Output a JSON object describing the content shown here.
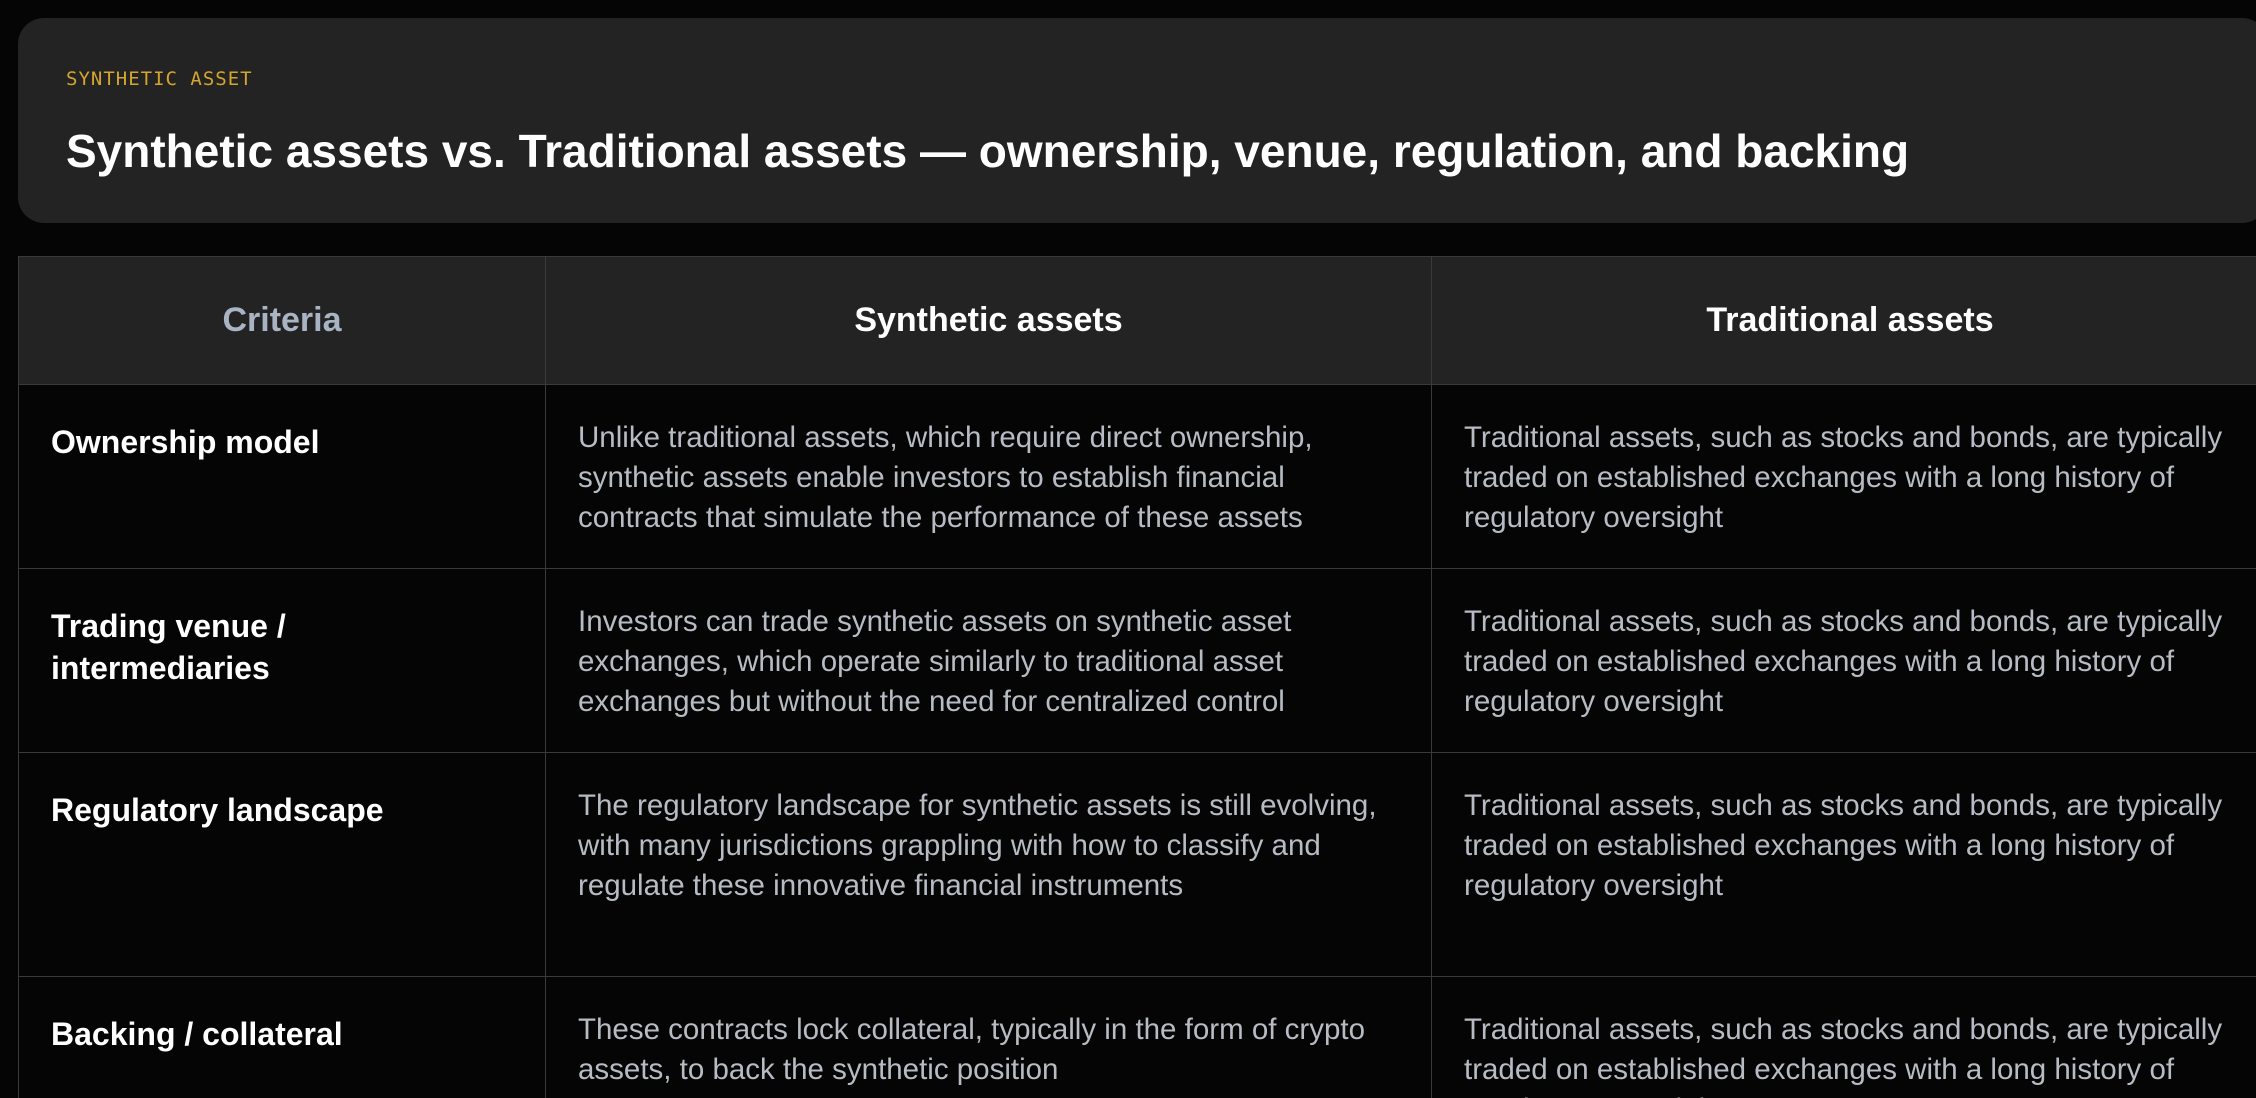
{
  "header": {
    "eyebrow": "SYNTHETIC ASSET",
    "title": "Synthetic assets vs. Traditional assets — ownership, venue, regulation, and backing"
  },
  "table": {
    "columns": [
      "Criteria",
      "Synthetic assets",
      "Traditional assets"
    ],
    "rows": [
      {
        "criteria": "Ownership model",
        "synthetic": "Unlike traditional assets, which require direct ownership, synthetic assets enable investors to establish financial contracts that simulate the performance of these assets",
        "traditional": "Traditional assets, such as stocks and bonds, are typically traded on established exchanges with a long history of regulatory oversight"
      },
      {
        "criteria": "Trading venue / intermediaries",
        "synthetic": "Investors can trade synthetic assets on synthetic asset exchanges, which operate similarly to traditional asset exchanges but without the need for centralized control",
        "traditional": "Traditional assets, such as stocks and bonds, are typically traded on established exchanges with a long history of regulatory oversight"
      },
      {
        "criteria": "Regulatory landscape",
        "synthetic": "The regulatory landscape for synthetic assets is still evolving, with many jurisdictions grappling with how to classify and regulate these innovative financial instruments",
        "traditional": "Traditional assets, such as stocks and bonds, are typically traded on established exchanges with a long history of regulatory oversight"
      },
      {
        "criteria": "Backing / collateral",
        "synthetic": "These contracts lock collateral, typically in the form of crypto assets, to back the synthetic position",
        "traditional": "Traditional assets, such as stocks and bonds, are typically traded on established exchanges with a long history of regulatory oversight"
      }
    ]
  },
  "colors": {
    "background": "#050505",
    "card": "#232323",
    "accent": "#d4a72c",
    "criteria_header": "#a8b4c4",
    "body_text": "#b7bcc4",
    "border": "#3a3a3a"
  }
}
